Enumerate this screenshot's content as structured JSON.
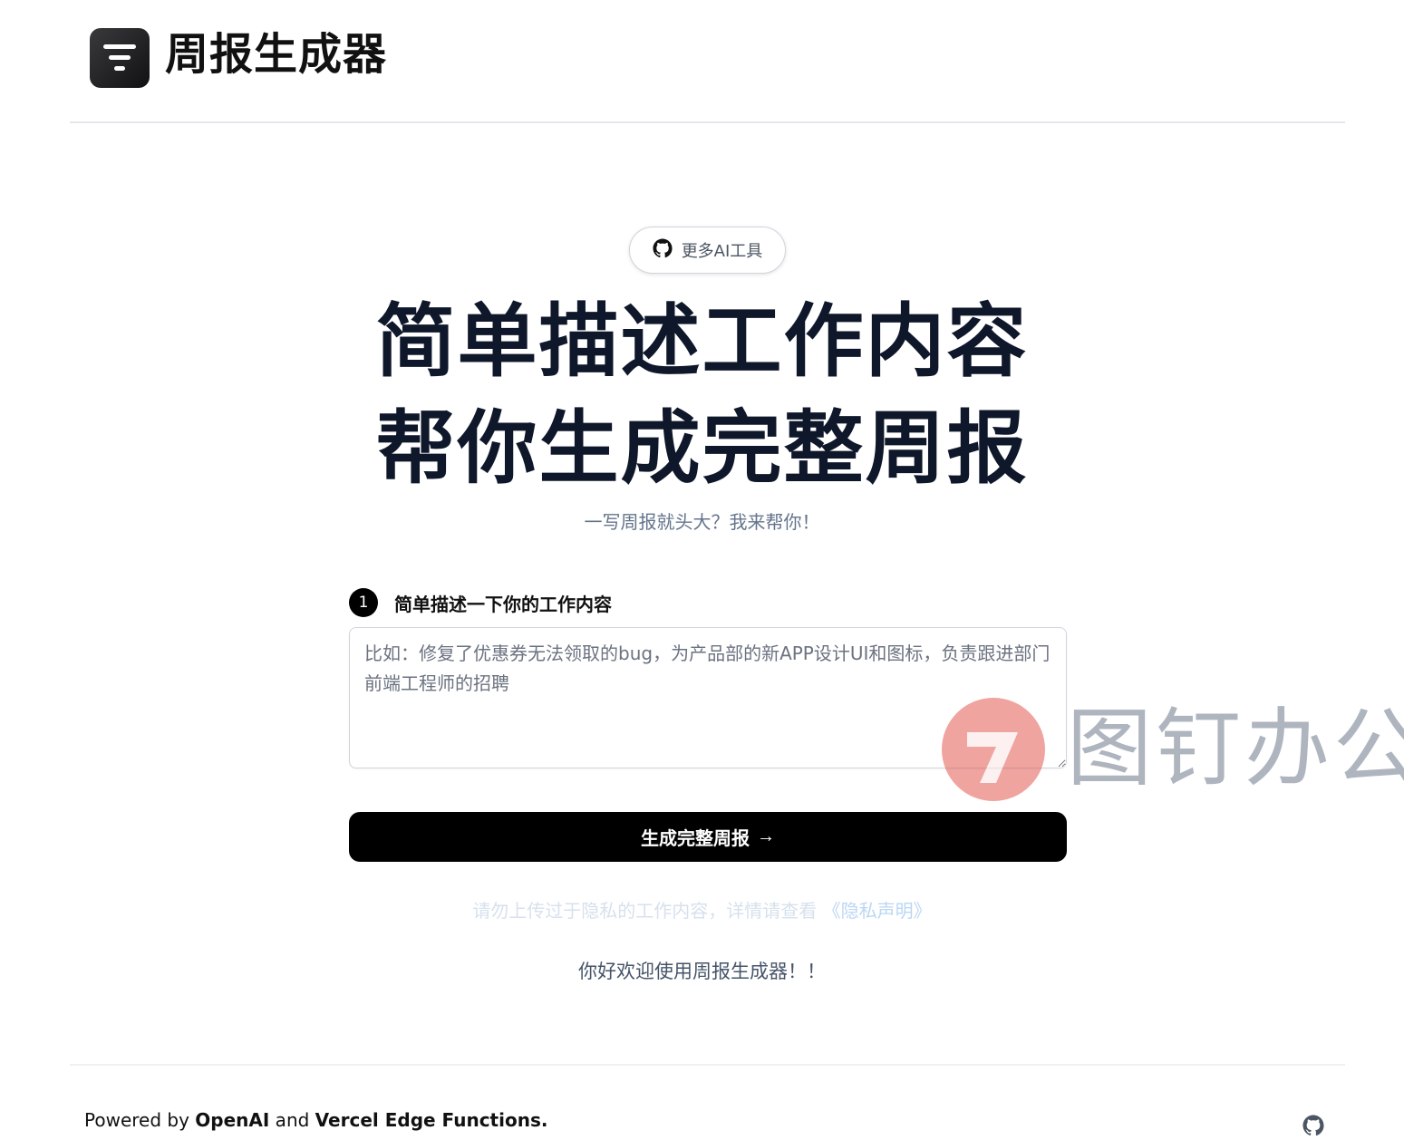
{
  "header": {
    "brand_name": "周报生成器",
    "logo_icon": "filter-lines-icon"
  },
  "github_pill": {
    "icon": "github-icon",
    "label": "更多AI工具"
  },
  "hero": {
    "title_line1": "简单描述工作内容",
    "title_line2": "帮你生成完整周报",
    "subtitle": "一写周报就头大？我来帮你！"
  },
  "step": {
    "number": "1",
    "label": "简单描述一下你的工作内容"
  },
  "work_input": {
    "value": "",
    "placeholder": "比如：修复了优惠券无法领取的bug，为产品部的新APP设计UI和图标，负责跟进部门前端工程师的招聘"
  },
  "generate_button": {
    "label": "生成完整周报",
    "arrow": "→"
  },
  "privacy": {
    "text": "请勿上传过于隐私的工作内容，详情请查看",
    "link": "《隐私声明》"
  },
  "welcome": "你好欢迎使用周报生成器！！",
  "watermark": {
    "text": "图钉办公",
    "logo": "pushpin-logo-icon"
  },
  "footer": {
    "prefix": "Powered by ",
    "openai": "OpenAI",
    "and": " and ",
    "vercel": "Vercel Edge Functions.",
    "github_icon": "github-icon"
  },
  "colors": {
    "primary": "#000000",
    "title": "#0f172a",
    "muted": "#64748b",
    "border": "#d1d5db"
  }
}
